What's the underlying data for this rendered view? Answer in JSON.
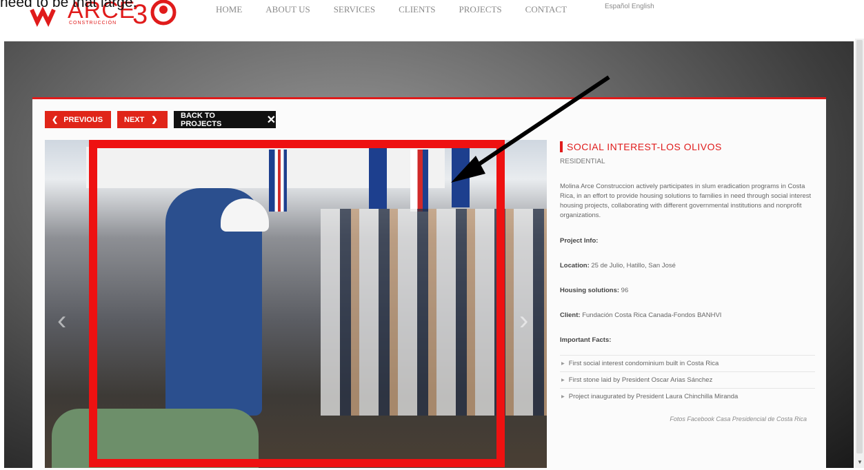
{
  "caption": "need to be that large.",
  "header": {
    "logo_text": "ARCE",
    "logo_sub": "CONSTRUCCIÓN",
    "nav": [
      "HOME",
      "ABOUT US",
      "SERVICES",
      "CLIENTS",
      "PROJECTS",
      "CONTACT"
    ],
    "lang": "Español English"
  },
  "toolbar": {
    "previous_label": "PREVIOUS",
    "next_label": "NEXT",
    "back_label": "BACK TO PROJECTS"
  },
  "project": {
    "title": "SOCIAL INTEREST-LOS OLIVOS",
    "category": "RESIDENTIAL",
    "description": "Molina Arce Construccion actively participates in  slum eradication programs in Costa Rica, in an effort to provide housing solutions to families in need through social interest housing projects, collaborating with different governmental institutions and nonprofit organizations.",
    "info_heading": "Project Info:",
    "location_label": "Location:",
    "location_value": "25 de Julio, Hatillo, San José",
    "housing_label": "Housing solutions:",
    "housing_value": "96",
    "client_label": "Client:",
    "client_value": "Fundación Costa Rica Canada-Fondos BANHVI",
    "facts_heading": "Important Facts:",
    "facts": [
      "First social interest condominium built in Costa Rica",
      "First stone laid by President Oscar Arias Sánchez",
      "Project inaugurated by President Laura Chinchilla Miranda"
    ],
    "credit": "Fotos Facebook Casa Presidencial de Costa Rica"
  },
  "colors": {
    "accent": "#e01b1b",
    "annotation_box": "#ee1111",
    "annotation_arrow": "#000000"
  }
}
